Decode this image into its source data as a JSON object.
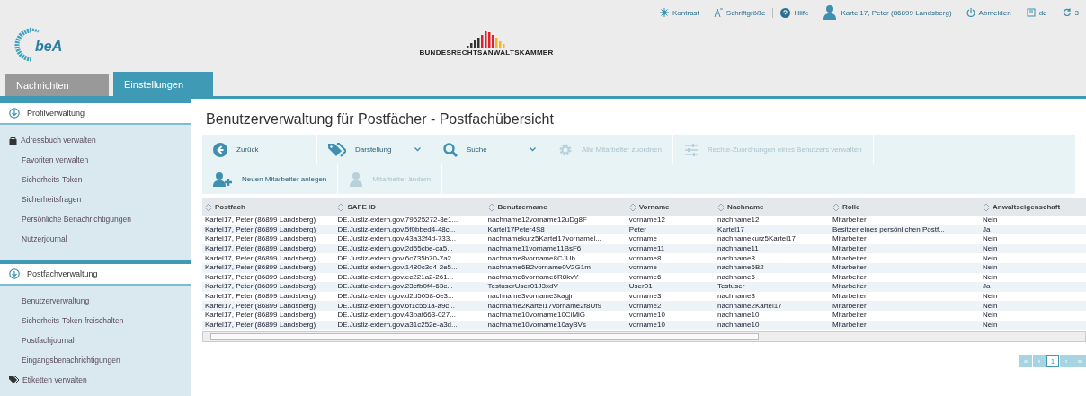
{
  "top_bar": {
    "items": [
      {
        "kind": "contrast",
        "label": "Kontrast"
      },
      {
        "kind": "font",
        "label": "Schriftgröße"
      },
      {
        "kind": "help",
        "label": "Hilfe"
      },
      {
        "kind": "user",
        "label": "Kartel17, Peter (86899 Landsberg)"
      },
      {
        "kind": "logout",
        "label": "Abmelden"
      },
      {
        "kind": "lang",
        "label": "de"
      },
      {
        "kind": "timer",
        "label": "3"
      }
    ]
  },
  "header": {
    "org": "BUNDESRECHTSANWALTSKAMMER",
    "logo_text": "beA"
  },
  "tabs": [
    {
      "label": "Nachrichten",
      "selected": false
    },
    {
      "label": "Einstellungen",
      "selected": true
    }
  ],
  "sidebar": {
    "sections": [
      {
        "title": "Profilverwaltung",
        "items": [
          {
            "label": "Adressbuch verwalten",
            "kind": "icon"
          },
          {
            "label": "Favoriten verwalten",
            "kind": "link"
          },
          {
            "label": "Sicherheits-Token",
            "kind": "link"
          },
          {
            "label": "Sicherheitsfragen",
            "kind": "link"
          },
          {
            "label": "Persönliche Benachrichtigungen",
            "kind": "link"
          },
          {
            "label": "Nutzerjournal",
            "kind": "link"
          }
        ]
      },
      {
        "title": "Postfachverwaltung",
        "items": [
          {
            "label": "Benutzerverwaltung",
            "kind": "link"
          },
          {
            "label": "Sicherheits-Token freischalten",
            "kind": "link"
          },
          {
            "label": "Postfachjournal",
            "kind": "link"
          },
          {
            "label": "Eingangsbenachrichtigungen",
            "kind": "link"
          },
          {
            "label": "Etiketten verwalten",
            "kind": "tag"
          }
        ]
      }
    ]
  },
  "page_title": "Benutzerverwaltung für Postfächer - Postfachübersicht",
  "toolbar": {
    "rows": [
      [
        {
          "kind": "back",
          "label": "Zurück",
          "disabled": false,
          "dropdown": false
        },
        {
          "kind": "tags",
          "label": "Darstellung",
          "disabled": false,
          "dropdown": true
        },
        {
          "kind": "search",
          "label": "Suche",
          "disabled": false,
          "dropdown": true
        },
        {
          "kind": "gear",
          "label": "Alle Mitarbeiter zuordnen",
          "disabled": true,
          "dropdown": false
        },
        {
          "kind": "sliders",
          "label": "Rechte-Zuordnungen eines Benutzers verwalten",
          "disabled": true,
          "dropdown": false
        }
      ],
      [
        {
          "kind": "adduser",
          "label": "Neuen Mitarbeiter anlegen",
          "disabled": false,
          "dropdown": false
        },
        {
          "kind": "user",
          "label": "Mitarbeiter ändern",
          "disabled": true,
          "dropdown": false
        }
      ]
    ]
  },
  "table": {
    "columns": [
      "Postfach",
      "SAFE ID",
      "Benutzername",
      "Vorname",
      "Nachname",
      "Rolle",
      "Anwaltseigenschaft"
    ],
    "rows": [
      [
        "Kartel17, Peter (86899 Landsberg)",
        "DE.Justiz-extern.gov.79525272-8e1...",
        "nachname12vorname12uDg8F",
        "vorname12",
        "nachname12",
        "Mitarbeiter",
        "Nein"
      ],
      [
        "Kartel17, Peter (86899 Landsberg)",
        "DE.Justiz-extern.gov.5f0bbed4-48c...",
        "Kartel17Peter4S8",
        "Peter",
        "Kartel17",
        "Besitzer eines persönlichen Postf...",
        "Ja"
      ],
      [
        "Kartel17, Peter (86899 Landsberg)",
        "DE.Justiz-extern.gov.43a32f4d-733...",
        "nachnamekurz5Kartel17vornamel...",
        "vorname",
        "nachnamekurz5Kartel17",
        "Mitarbeiter",
        "Nein"
      ],
      [
        "Kartel17, Peter (86899 Landsberg)",
        "DE.Justiz-extern.gov.2d55cbe-ca5...",
        "nachname11vorname11BsF6",
        "vorname11",
        "nachname11",
        "Mitarbeiter",
        "Nein"
      ],
      [
        "Kartel17, Peter (86899 Landsberg)",
        "DE.Justiz-extern.gov.6c735b70-7a2...",
        "nachname8vorname8CJUb",
        "vorname8",
        "nachname8",
        "Mitarbeiter",
        "Nein"
      ],
      [
        "Kartel17, Peter (86899 Landsberg)",
        "DE.Justiz-extern.gov.1480c3d4-2e5...",
        "nachname6B2vorname0V2G1m",
        "vorname",
        "nachname6B2",
        "Mitarbeiter",
        "Nein"
      ],
      [
        "Kartel17, Peter (86899 Landsberg)",
        "DE.Justiz-extern.gov.ec221a2-261...",
        "nachname6vorname6R8kvY",
        "vorname6",
        "nachname6",
        "Mitarbeiter",
        "Nein"
      ],
      [
        "Kartel17, Peter (86899 Landsberg)",
        "DE.Justiz-extern.gov.23cfb0f4-63c...",
        "TestuserUser01J3xdV",
        "User01",
        "Testuser",
        "Mitarbeiter",
        "Ja"
      ],
      [
        "Kartel17, Peter (86899 Landsberg)",
        "DE.Justiz-extern.gov.d2d5058-6e3...",
        "nachname3vorname3kagjr",
        "vorname3",
        "nachname3",
        "Mitarbeiter",
        "Nein"
      ],
      [
        "Kartel17, Peter (86899 Landsberg)",
        "DE.Justiz-extern.gov.6f1c551a-a9c...",
        "nachname2Kartel17vorname2f8Uf9",
        "vorname2",
        "nachname2Kartel17",
        "Mitarbeiter",
        "Nein"
      ],
      [
        "Kartel17, Peter (86899 Landsberg)",
        "DE.Justiz-extern.gov.43baf663-027...",
        "nachname10vorname10CiMiG",
        "vorname10",
        "nachname10",
        "Mitarbeiter",
        "Nein"
      ],
      [
        "Kartel17, Peter (86899 Landsberg)",
        "DE.Justiz-extern.gov.a31c252e-a3d...",
        "nachname10vorname10ayBVs",
        "vorname10",
        "nachname10",
        "Mitarbeiter",
        "Nein"
      ]
    ]
  },
  "pagination": [
    {
      "label": "«",
      "selected": false
    },
    {
      "label": "‹",
      "selected": false
    },
    {
      "label": "1",
      "selected": true
    },
    {
      "label": "›",
      "selected": false
    },
    {
      "label": "»",
      "selected": false
    }
  ]
}
